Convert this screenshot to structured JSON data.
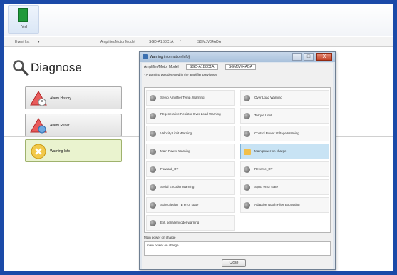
{
  "ribbon": {
    "app_label": "Vrd"
  },
  "infobar": {
    "event_label": "Event list",
    "motor_label": "Amplifier/Motor Model",
    "motor_value": "SGD-A1B8C1A",
    "separator": "/",
    "motor_value2": "SGMJV04ADA"
  },
  "diagnose": {
    "title": "Diagnose",
    "buttons": [
      {
        "label": "Alarm History"
      },
      {
        "label": "Alarm Reset"
      },
      {
        "label": "Warning Info"
      }
    ]
  },
  "dialog": {
    "title": "Warning information(Info)",
    "controls": {
      "minimize": "_",
      "maximize": "□",
      "close": "X"
    },
    "model_label": "Amplifier/Motor Model",
    "model_value": "SGD-A1B8C1A",
    "model_value2": "SGMJV04ADA",
    "note": "* A warning was detected in the amplifier previously.",
    "warnings": [
      {
        "label": "Servo Amplifier Temp. Warning",
        "active": false
      },
      {
        "label": "Over Load Warning",
        "active": false
      },
      {
        "label": "Regenerative Resistor Over Load Warning",
        "active": false
      },
      {
        "label": "Torque Limit",
        "active": false
      },
      {
        "label": "Velocity Limit Warning",
        "active": false
      },
      {
        "label": "Control Power Voltage Warning",
        "active": false
      },
      {
        "label": "Main Power Warning",
        "active": false
      },
      {
        "label": "Main power on charge",
        "active": true
      },
      {
        "label": "Forward_OT",
        "active": false
      },
      {
        "label": "Reverse_OT",
        "active": false
      },
      {
        "label": "Serial Encoder Warning",
        "active": false
      },
      {
        "label": "Sync. error state",
        "active": false
      },
      {
        "label": "Subscription TB error state",
        "active": false
      },
      {
        "label": "Adaptive Notch Filter Excessing",
        "active": false
      },
      {
        "label": "Ext. serial encoder warning",
        "active": false
      }
    ],
    "reason_label": "Main power on charge",
    "reason_text": "main power on charge",
    "close_label": "Close"
  },
  "colors": {
    "frame": "#1b4aa8",
    "active_item": "#c8e3f4",
    "active_button": "#eaf3cf"
  }
}
